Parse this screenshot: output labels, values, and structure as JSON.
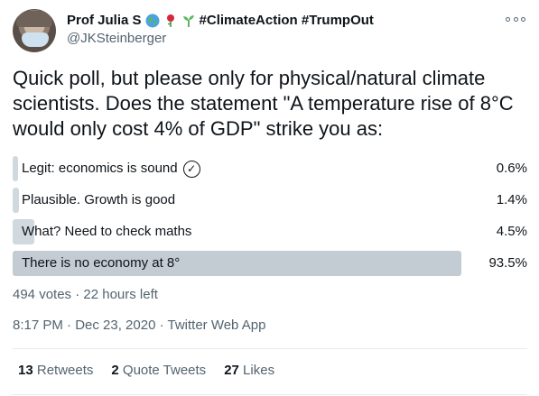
{
  "author": {
    "display_name": "Prof Julia S",
    "hashtags": "#ClimateAction #TrumpOut",
    "handle": "@JKSteinberger",
    "emoji_icons": [
      "globe-icon",
      "rose-icon",
      "seedling-icon"
    ]
  },
  "tweet": {
    "text": "Quick poll, but please only for physical/natural climate scientists. Does the statement \"A temperature rise of 8°C would only cost 4% of GDP\" strike you as:"
  },
  "poll": {
    "options": [
      {
        "label": "Legit: economics is sound",
        "percent": "0.6%",
        "value": 0.6,
        "has_check_icon": true
      },
      {
        "label": "Plausible. Growth is good",
        "percent": "1.4%",
        "value": 1.4
      },
      {
        "label": "What? Need to check maths",
        "percent": "4.5%",
        "value": 4.5
      },
      {
        "label": "There is no economy at 8°",
        "percent": "93.5%",
        "value": 93.5,
        "winner": true
      }
    ],
    "meta": "494 votes · 22 hours left"
  },
  "timestamp": "8:17 PM · Dec 23, 2020 · Twitter Web App",
  "stats": {
    "retweets_count": "13",
    "retweets_label": "Retweets",
    "quotes_count": "2",
    "quotes_label": "Quote Tweets",
    "likes_count": "27",
    "likes_label": "Likes"
  },
  "colors": {
    "bar": "#cfd9de",
    "winner_bar": "#c3ccd3",
    "secondary_text": "#536471"
  }
}
